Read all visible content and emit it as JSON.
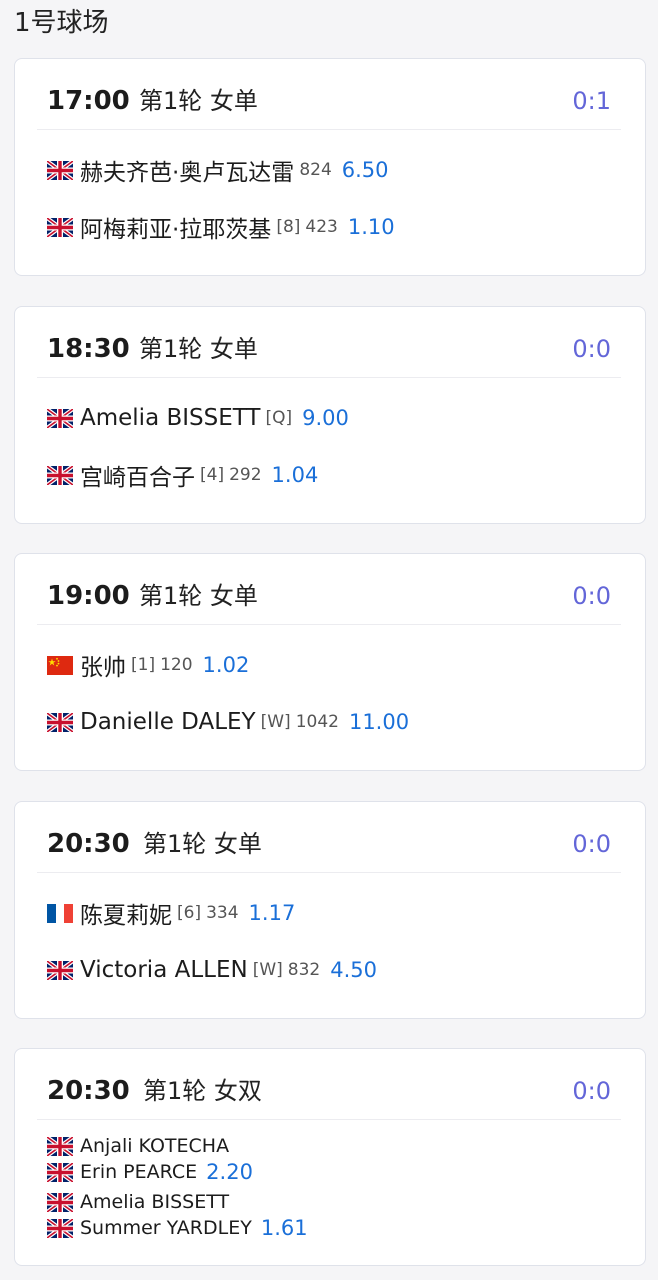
{
  "court": {
    "title": "1号球场"
  },
  "colors": {
    "score": "#6366d8",
    "odds": "#1a6fd8"
  },
  "matches": [
    {
      "time": "17:00",
      "round": "第1轮 女单",
      "score": "0:1",
      "players": [
        {
          "flag": "gb-flag-icon",
          "name": "赫夫齐芭·奥卢瓦达雷",
          "seed": "",
          "rank": "824",
          "odds": "6.50"
        },
        {
          "flag": "gb-flag-icon",
          "name": "阿梅莉亚·拉耶茨基",
          "seed": "[8]",
          "rank": "423",
          "odds": "1.10"
        }
      ]
    },
    {
      "time": "18:30",
      "round": "第1轮 女单",
      "score": "0:0",
      "players": [
        {
          "flag": "gb-flag-icon",
          "name": "Amelia BISSETT",
          "seed": "[Q]",
          "rank": "",
          "odds": "9.00"
        },
        {
          "flag": "gb-flag-icon",
          "name": "宫崎百合子",
          "seed": "[4]",
          "rank": "292",
          "odds": "1.04"
        }
      ]
    },
    {
      "time": "19:00",
      "round": "第1轮 女单",
      "score": "0:0",
      "players": [
        {
          "flag": "cn-flag-icon",
          "name": "张帅",
          "seed": "[1]",
          "rank": "120",
          "odds": "1.02"
        },
        {
          "flag": "gb-flag-icon",
          "name": "Danielle DALEY",
          "seed": "[W]",
          "rank": "1042",
          "odds": "11.00"
        }
      ]
    },
    {
      "time": "20:30",
      "round": "第1轮 女单",
      "score": "0:0",
      "players": [
        {
          "flag": "fr-flag-icon",
          "name": "陈夏莉妮",
          "seed": "[6]",
          "rank": "334",
          "odds": "1.17"
        },
        {
          "flag": "gb-flag-icon",
          "name": "Victoria ALLEN",
          "seed": "[W]",
          "rank": "832",
          "odds": "4.50"
        }
      ]
    },
    {
      "time": "20:30",
      "round": "第1轮 女双",
      "score": "0:0",
      "teams": [
        {
          "odds": "2.20",
          "members": [
            {
              "flag": "gb-flag-icon",
              "name": "Anjali KOTECHA"
            },
            {
              "flag": "gb-flag-icon",
              "name": "Erin PEARCE"
            }
          ]
        },
        {
          "odds": "1.61",
          "members": [
            {
              "flag": "gb-flag-icon",
              "name": "Amelia BISSETT"
            },
            {
              "flag": "gb-flag-icon",
              "name": "Summer YARDLEY"
            }
          ]
        }
      ]
    }
  ]
}
